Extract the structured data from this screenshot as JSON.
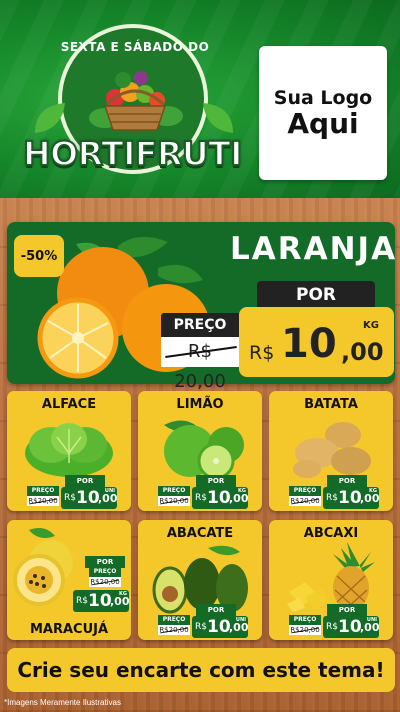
{
  "header": {
    "badge_top": "SEXTA E SÁBADO DO",
    "badge_title": "HORTIFRUTI",
    "logo_line1": "Sua Logo",
    "logo_line2": "Aqui"
  },
  "featured": {
    "discount": "-50%",
    "name": "LARANJA",
    "por_label": "POR",
    "preco_label": "PREÇO",
    "old_price": "R$ 20,00",
    "currency": "R$",
    "price_int": "10",
    "price_dec": ",00",
    "unit": "KG"
  },
  "products": [
    {
      "name": "ALFACE",
      "preco_label": "PREÇO",
      "old_price": "R$20,00",
      "por_label": "POR",
      "currency": "R$",
      "price_int": "10",
      "price_dec": ",00",
      "unit": "UNI"
    },
    {
      "name": "LIMÃO",
      "preco_label": "PREÇO",
      "old_price": "R$20,00",
      "por_label": "POR",
      "currency": "R$",
      "price_int": "10",
      "price_dec": ",00",
      "unit": "KG"
    },
    {
      "name": "BATATA",
      "preco_label": "PREÇO",
      "old_price": "R$20,00",
      "por_label": "POR",
      "currency": "R$",
      "price_int": "10",
      "price_dec": ",00",
      "unit": "KG"
    },
    {
      "name": "MARACUJÁ",
      "preco_label": "PREÇO",
      "old_price": "R$20,00",
      "por_label": "POR",
      "currency": "R$",
      "price_int": "10",
      "price_dec": ",00",
      "unit": "KG"
    },
    {
      "name": "ABACATE",
      "preco_label": "PREÇO",
      "old_price": "R$20,00",
      "por_label": "POR",
      "currency": "R$",
      "price_int": "10",
      "price_dec": ",00",
      "unit": "UNI"
    },
    {
      "name": "ABCAXI",
      "preco_label": "PREÇO",
      "old_price": "R$20,00",
      "por_label": "POR",
      "currency": "R$",
      "price_int": "10",
      "price_dec": ",00",
      "unit": "UNI"
    }
  ],
  "footer": {
    "banner": "Crie seu encarte com este tema!",
    "disclaimer": "*Imagens Meramente Ilustrativas"
  },
  "colors": {
    "green": "#146b27",
    "yellow": "#f4c82a",
    "header_green": "#15862a"
  }
}
